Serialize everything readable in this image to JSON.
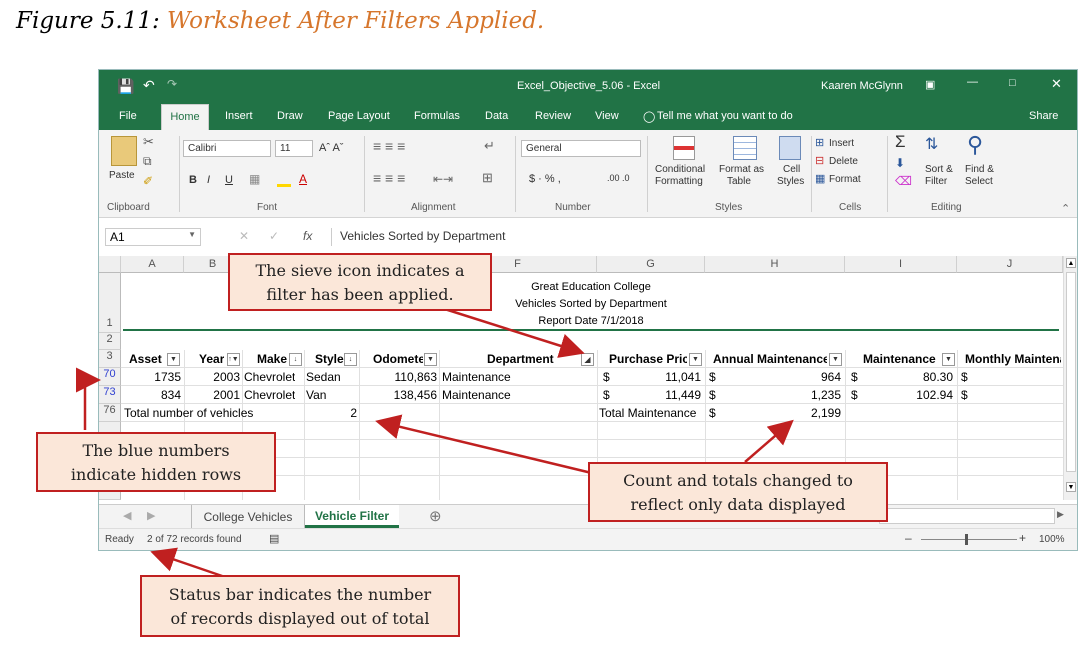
{
  "caption": {
    "prefix": "Figure 5.11:",
    "title": "Worksheet After Filters Applied."
  },
  "window": {
    "filename": "Excel_Objective_5.06 - Excel",
    "user": "Kaaren McGlynn",
    "tabs": [
      "File",
      "Home",
      "Insert",
      "Draw",
      "Page Layout",
      "Formulas",
      "Data",
      "Review",
      "View"
    ],
    "tell_me": "Tell me what you want to do",
    "share": "Share"
  },
  "ribbon": {
    "paste": "Paste",
    "clipboard": "Clipboard",
    "font_name": "Calibri",
    "font_size": "11",
    "font": "Font",
    "alignment": "Alignment",
    "number_format": "General",
    "number": "Number",
    "conditional": "Conditional",
    "formatting": "Formatting",
    "format_as": "Format as",
    "table": "Table",
    "cell": "Cell",
    "styles_btn": "Styles",
    "styles": "Styles",
    "insert": "Insert",
    "delete": "Delete",
    "format": "Format",
    "cells": "Cells",
    "sort": "Sort &",
    "filter": "Filter",
    "find": "Find &",
    "select": "Select",
    "editing": "Editing"
  },
  "formula": {
    "namebox": "A1",
    "fx": "fx",
    "value": "Vehicles Sorted by Department"
  },
  "columns": [
    "A",
    "B",
    "C",
    "D",
    "E",
    "F",
    "G",
    "H",
    "I",
    "J"
  ],
  "title_block": [
    "Great Education College",
    "Vehicles Sorted by Department",
    "Report Date 7/1/2018"
  ],
  "row_numbers": [
    "1",
    "2",
    "3",
    "70",
    "73",
    "76"
  ],
  "headers": [
    "Asset",
    "Year",
    "Make",
    "Style",
    "Odometer",
    "Department",
    "Purchase Price",
    "Annual Maintenance",
    "Maintenance",
    "Monthly Maintenance"
  ],
  "rows": [
    {
      "asset": "1735",
      "year": "2003",
      "make": "Chevrolet",
      "style": "Sedan",
      "odometer": "110,863",
      "dept": "Maintenance",
      "d1": "$",
      "price": "11,041",
      "d2": "$",
      "annual": "964",
      "d3": "$",
      "maint": "80.30",
      "d4": "$"
    },
    {
      "asset": "834",
      "year": "2001",
      "make": "Chevrolet",
      "style": "Van",
      "odometer": "138,456",
      "dept": "Maintenance",
      "d1": "$",
      "price": "11,449",
      "d2": "$",
      "annual": "1,235",
      "d3": "$",
      "maint": "102.94",
      "d4": "$"
    }
  ],
  "totals": {
    "label": "Total number of vehicles",
    "count": "2",
    "maint_label": "Total Maintenance",
    "dollar": "$",
    "maint_total": "2,199"
  },
  "sheets": [
    "College Vehicles",
    "Vehicle Filter"
  ],
  "status": {
    "ready": "Ready",
    "records": "2 of 72 records found",
    "zoom": "100%"
  },
  "callouts": {
    "sieve": [
      "The sieve icon indicates a",
      "filter has been applied."
    ],
    "blue": [
      "The blue numbers",
      "indicate hidden rows"
    ],
    "count": [
      "Count and totals changed to",
      "reflect only data displayed"
    ],
    "status": [
      "Status bar indicates the number",
      "of records displayed out of total"
    ]
  },
  "colors": {
    "excel_green": "#217346",
    "callout_border": "#c02020",
    "callout_fill": "#fbe7d9",
    "caption_accent": "#d6762c",
    "hidden_row": "#2f3fd0"
  }
}
